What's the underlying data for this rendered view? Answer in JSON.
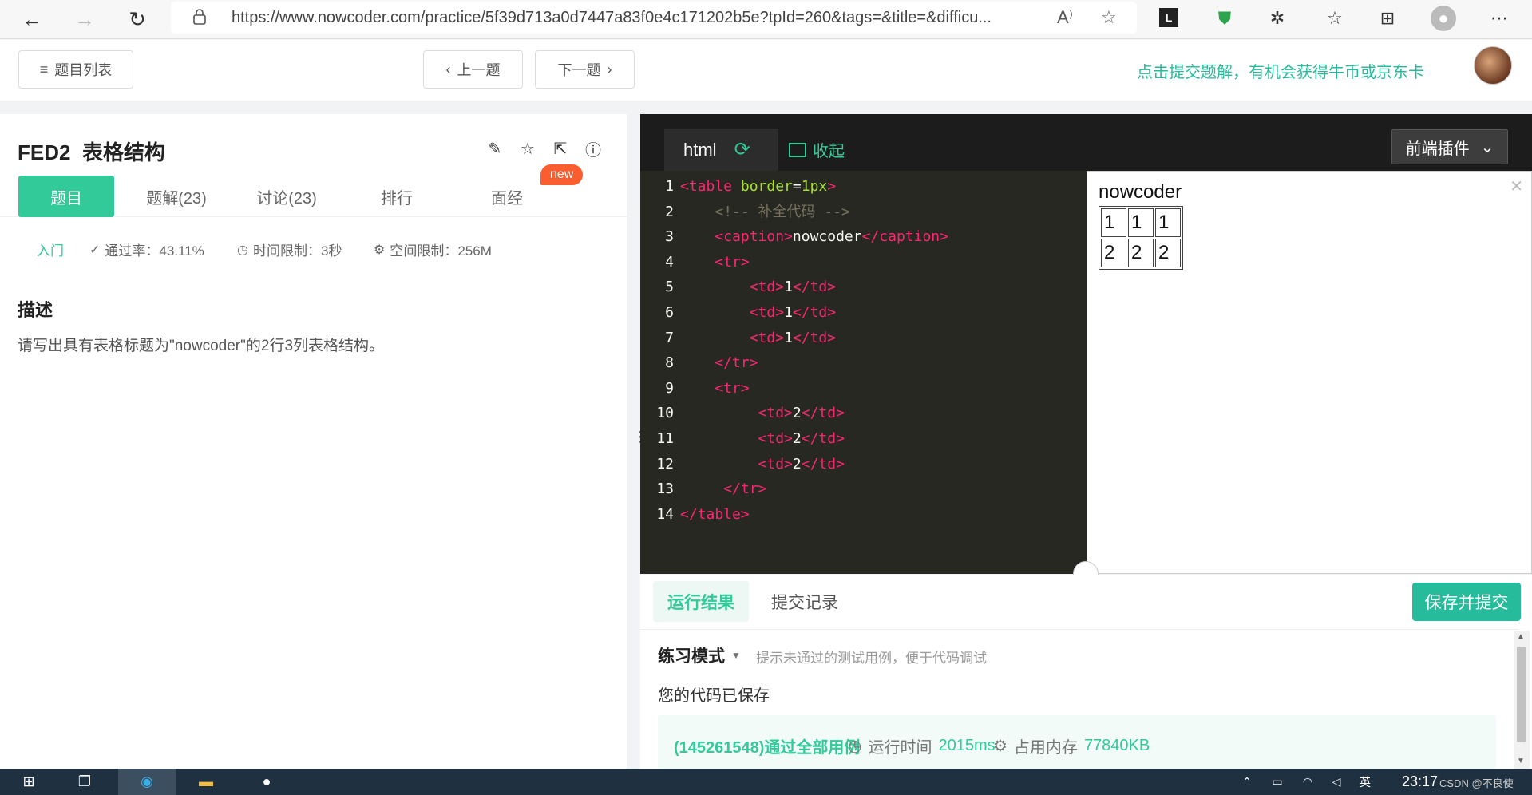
{
  "browser": {
    "url": "https://www.nowcoder.com/practice/5f39d713a0d7447a83f0e4c171202b5e?tpId=260&tags=&title=&difficu..."
  },
  "header": {
    "problem_list": "题目列表",
    "prev": "上一题",
    "next": "下一题",
    "promo": "点击提交题解，有机会获得牛币或京东卡"
  },
  "question": {
    "id": "FED2",
    "title": "表格结构",
    "tabs": [
      {
        "label": "题目"
      },
      {
        "label": "题解(23)"
      },
      {
        "label": "讨论(23)"
      },
      {
        "label": "排行"
      },
      {
        "label": "面经"
      }
    ],
    "new_badge": "new",
    "level": "入门",
    "pass_rate": "通过率：43.11%",
    "time_limit": "时间限制：3秒",
    "space_limit": "空间限制：256M",
    "desc_heading": "描述",
    "description": "请写出具有表格标题为\"nowcoder\"的2行3列表格结构。"
  },
  "editor": {
    "language": "html",
    "collapse_label": "收起",
    "plugin_label": "前端插件",
    "lines": [
      {
        "n": "1",
        "indent": "",
        "parts": [
          [
            "tg",
            "<table "
          ],
          [
            "at",
            "border"
          ],
          [
            "tx",
            "="
          ],
          [
            "at",
            "1px"
          ],
          [
            "tg",
            ">"
          ]
        ]
      },
      {
        "n": "2",
        "indent": "    ",
        "parts": [
          [
            "cm",
            "<!-- 补全代码 -->"
          ]
        ]
      },
      {
        "n": "3",
        "indent": "    ",
        "parts": [
          [
            "tg",
            "<caption>"
          ],
          [
            "tx",
            "nowcoder"
          ],
          [
            "tg",
            "</caption>"
          ]
        ]
      },
      {
        "n": "4",
        "indent": "    ",
        "parts": [
          [
            "tg",
            "<tr>"
          ]
        ]
      },
      {
        "n": "5",
        "indent": "        ",
        "parts": [
          [
            "tg",
            "<td>"
          ],
          [
            "tx",
            "1"
          ],
          [
            "tg",
            "</td>"
          ]
        ]
      },
      {
        "n": "6",
        "indent": "        ",
        "parts": [
          [
            "tg",
            "<td>"
          ],
          [
            "tx",
            "1"
          ],
          [
            "tg",
            "</td>"
          ]
        ]
      },
      {
        "n": "7",
        "indent": "        ",
        "parts": [
          [
            "tg",
            "<td>"
          ],
          [
            "tx",
            "1"
          ],
          [
            "tg",
            "</td>"
          ]
        ]
      },
      {
        "n": "8",
        "indent": "    ",
        "parts": [
          [
            "tg",
            "</tr>"
          ]
        ]
      },
      {
        "n": "9",
        "indent": "    ",
        "parts": [
          [
            "tg",
            "<tr>"
          ]
        ]
      },
      {
        "n": "10",
        "indent": "         ",
        "parts": [
          [
            "tg",
            "<td>"
          ],
          [
            "tx",
            "2"
          ],
          [
            "tg",
            "</td>"
          ]
        ]
      },
      {
        "n": "11",
        "indent": "         ",
        "parts": [
          [
            "tg",
            "<td>"
          ],
          [
            "tx",
            "2"
          ],
          [
            "tg",
            "</td>"
          ]
        ]
      },
      {
        "n": "12",
        "indent": "         ",
        "parts": [
          [
            "tg",
            "<td>"
          ],
          [
            "tx",
            "2"
          ],
          [
            "tg",
            "</td>"
          ]
        ]
      },
      {
        "n": "13",
        "indent": "     ",
        "parts": [
          [
            "tg",
            "</tr>"
          ]
        ]
      },
      {
        "n": "14",
        "indent": "",
        "parts": [
          [
            "tg",
            "</table>"
          ]
        ]
      }
    ]
  },
  "preview": {
    "caption": "nowcoder",
    "rows": [
      [
        "1",
        "1",
        "1"
      ],
      [
        "2",
        "2",
        "2"
      ]
    ]
  },
  "result": {
    "tab_result": "运行结果",
    "tab_history": "提交记录",
    "submit": "保存并提交",
    "mode": "练习模式",
    "hint": "提示未通过的测试用例，便于代码调试",
    "saved": "您的代码已保存",
    "pass": "(145261548)通过全部用例",
    "runtime_label": "运行时间",
    "runtime": "2015ms",
    "memory_label": "占用内存",
    "memory": "77840KB"
  },
  "taskbar": {
    "clock": "23:17",
    "watermark": "CSDN @不良使"
  }
}
